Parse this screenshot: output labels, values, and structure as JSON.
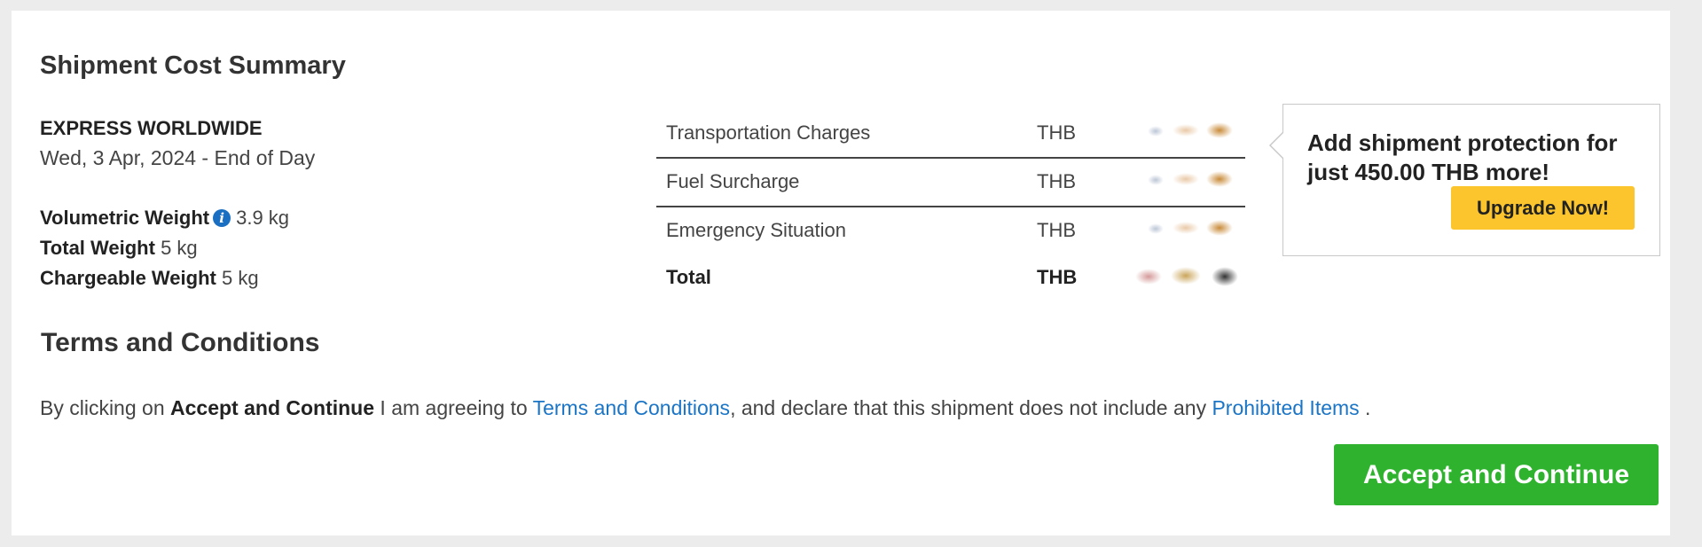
{
  "summary": {
    "title": "Shipment Cost Summary",
    "product": "EXPRESS WORLDWIDE",
    "delivery_date": "Wed, 3 Apr, 2024 - End of Day",
    "weights": [
      {
        "label": "Volumetric Weight",
        "value": "3.9 kg",
        "info": true
      },
      {
        "label": "Total Weight",
        "value": "5 kg",
        "info": false
      },
      {
        "label": "Chargeable Weight",
        "value": "5 kg",
        "info": false
      }
    ]
  },
  "charges": {
    "rows": [
      {
        "label": "Transportation Charges",
        "currency": "THB"
      },
      {
        "label": "Fuel Surcharge",
        "currency": "THB"
      },
      {
        "label": "Emergency Situation",
        "currency": "THB"
      }
    ],
    "total": {
      "label": "Total",
      "currency": "THB"
    }
  },
  "promo": {
    "text": "Add shipment protection for just 450.00 THB more!",
    "button_label": "Upgrade Now!",
    "button_color": "#fcc52d"
  },
  "terms": {
    "title": "Terms and Conditions",
    "prefix": "By clicking on ",
    "bold": "Accept and Continue",
    "middle": " I am agreeing to ",
    "link1": "Terms and Conditions",
    "after_link": ", and declare that this shipment does not include any ",
    "link2": "Prohibited Items",
    "suffix": " ."
  },
  "actions": {
    "accept_label": "Accept and Continue",
    "accept_color": "#2fb32f"
  },
  "colors": {
    "link": "#1b75c6",
    "info_icon": "#1b6fc2"
  }
}
